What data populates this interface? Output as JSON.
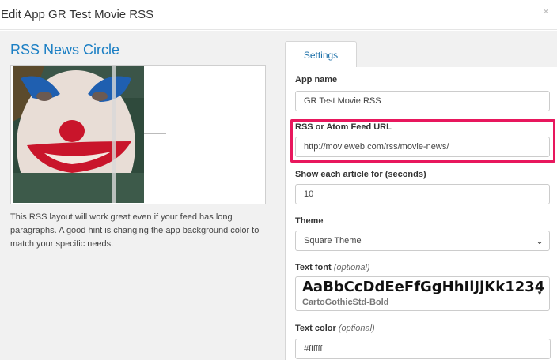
{
  "dialog": {
    "title": "Edit App GR Test Movie RSS",
    "close_icon": "×"
  },
  "preview": {
    "heading": "RSS News Circle",
    "description": "This RSS layout will work great even if your feed has long paragraphs. A good hint is changing the app background color to match your specific needs."
  },
  "tabs": [
    {
      "label": "Settings",
      "active": true
    }
  ],
  "settings": {
    "app_name": {
      "label": "App name",
      "value": "GR Test Movie RSS"
    },
    "feed_url": {
      "label": "RSS or Atom Feed URL",
      "value": "http://movieweb.com/rss/movie-news/"
    },
    "duration": {
      "label": "Show each article for (seconds)",
      "value": "10"
    },
    "theme": {
      "label": "Theme",
      "value": "Square Theme",
      "chevron": "⌄"
    },
    "text_font": {
      "label": "Text font",
      "optional": "(optional)",
      "sample": "AaBbCcDdEeFfGgHhIiJjKk1234",
      "name": "CartoGothicStd-Bold",
      "caret": "▼"
    },
    "text_color": {
      "label": "Text color",
      "optional": "(optional)",
      "value": "#ffffff"
    }
  },
  "colors": {
    "accent_blue": "#1b7fc4",
    "highlight": "#e8175d",
    "panel_bg": "#f1f1f1"
  }
}
